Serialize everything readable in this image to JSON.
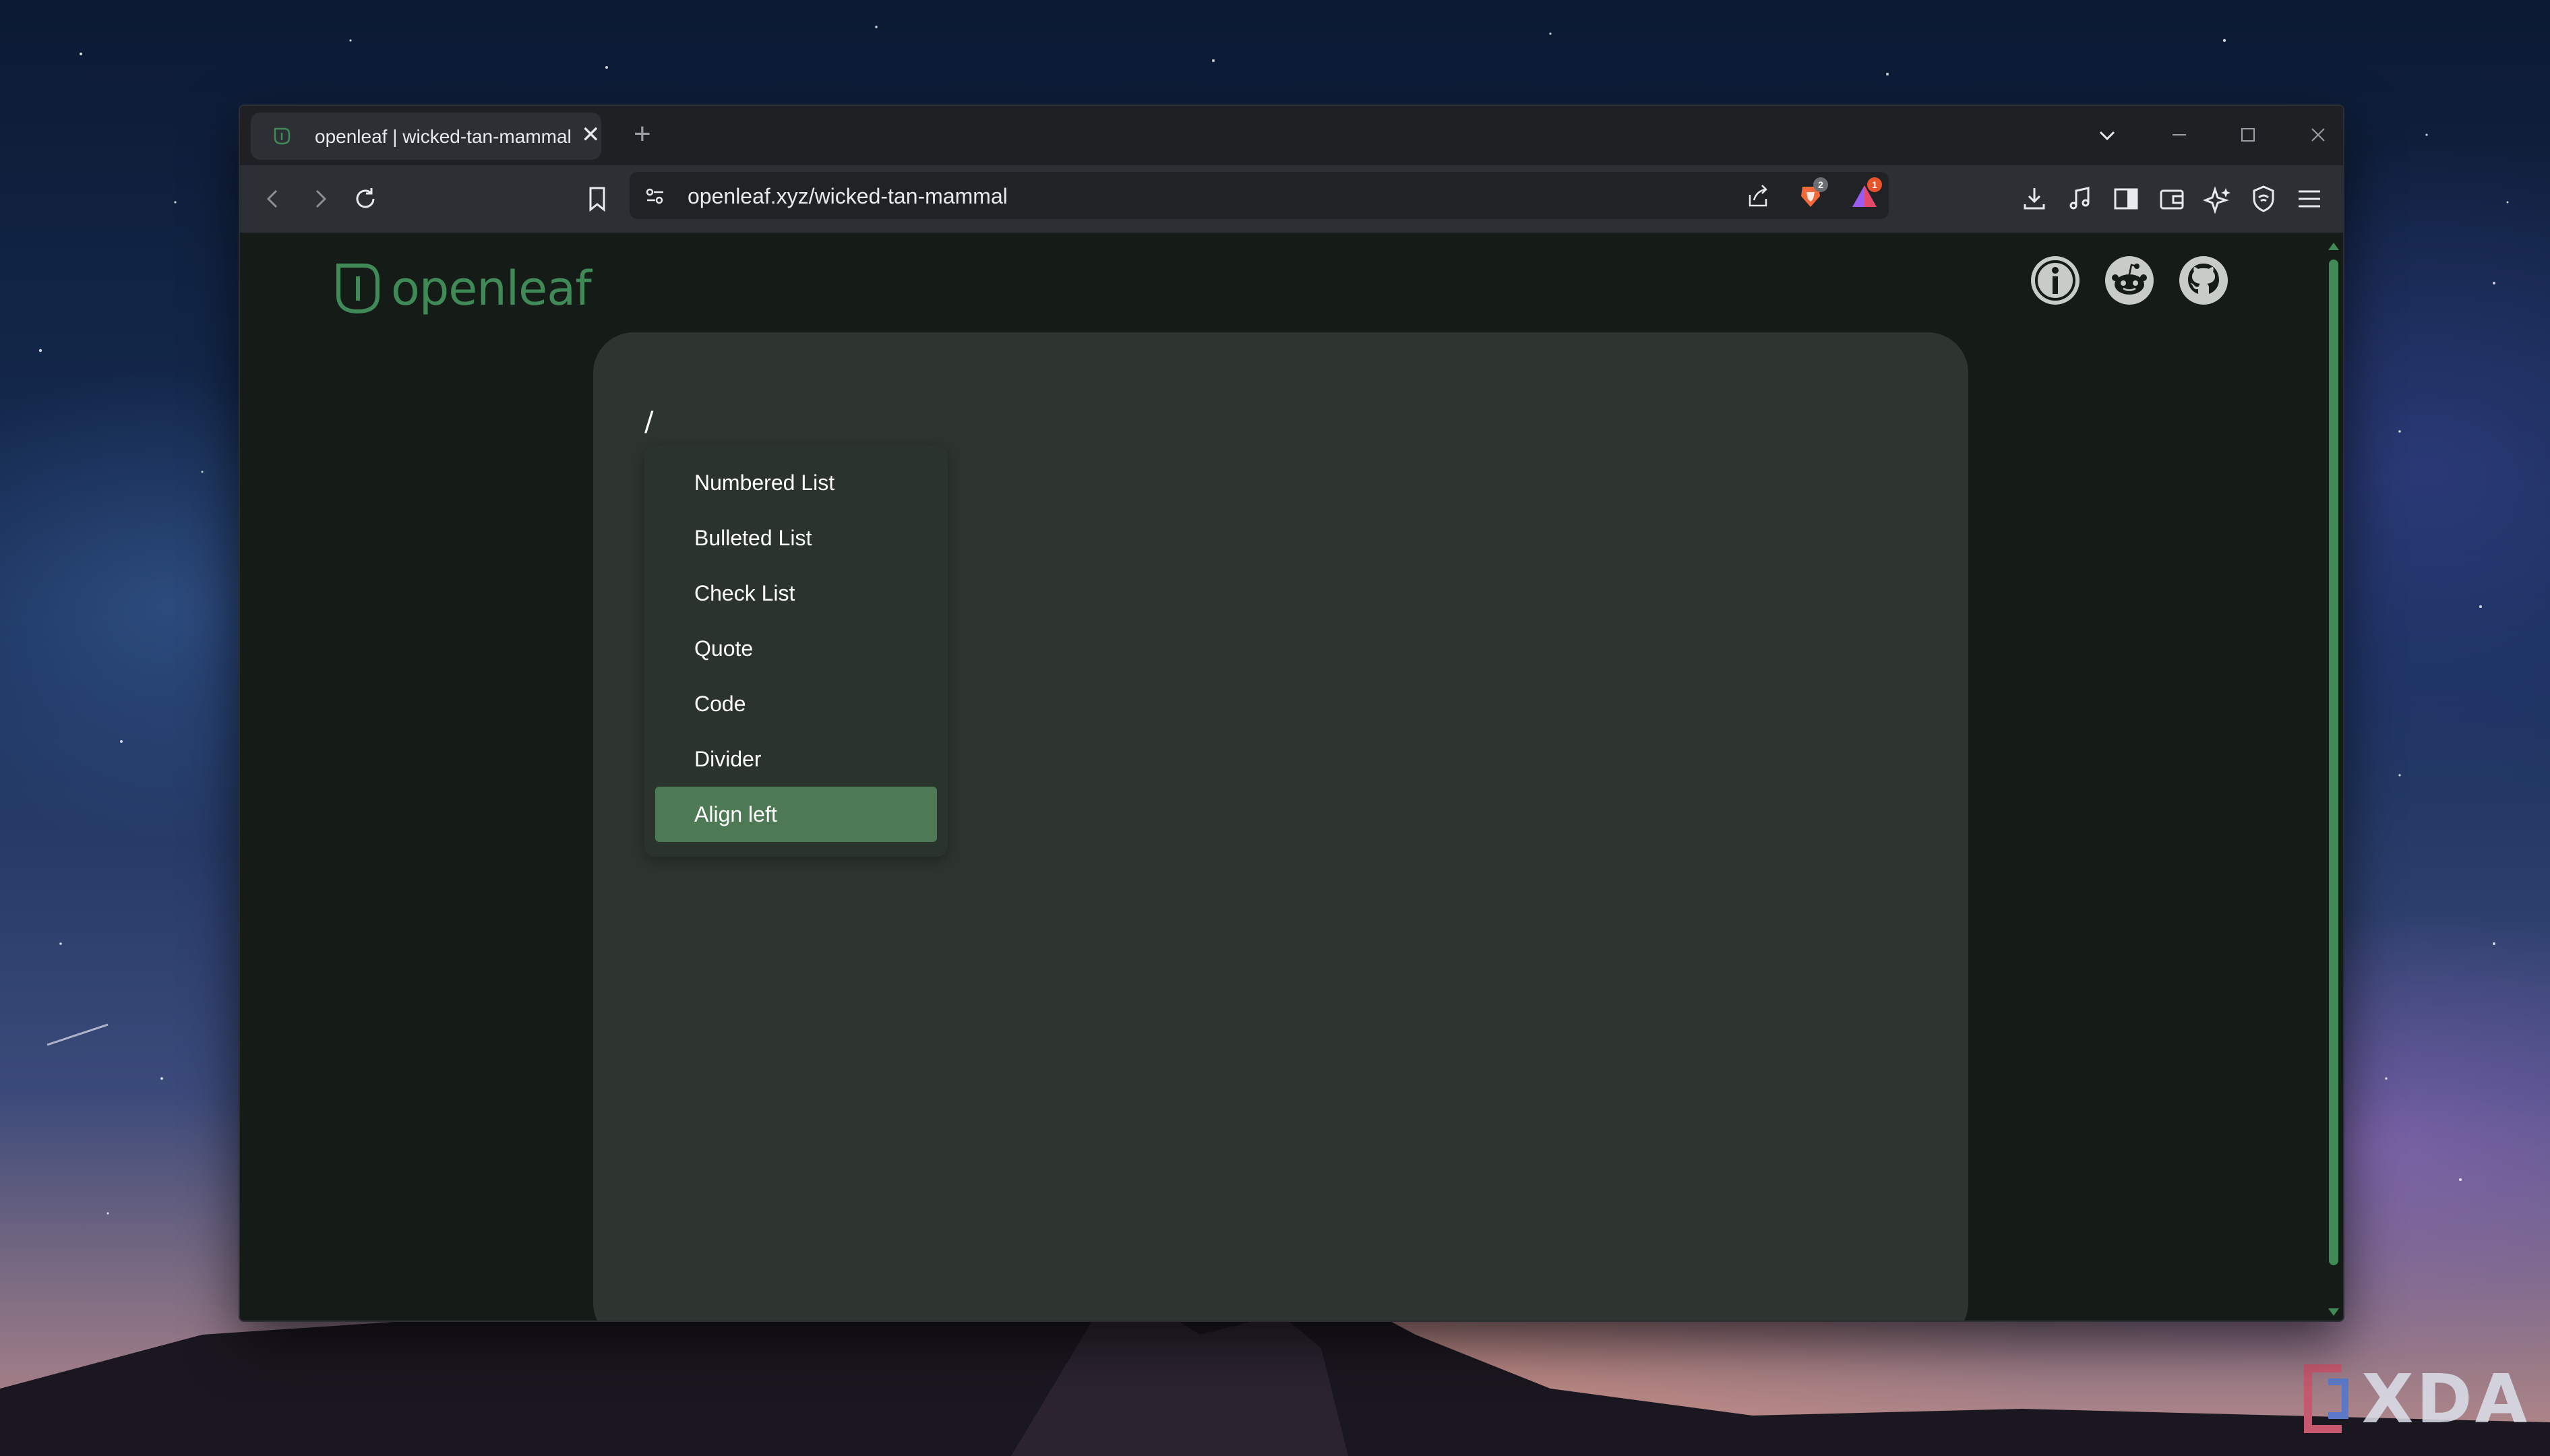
{
  "browser": {
    "tab": {
      "title": "openleaf | wicked-tan-mammal",
      "close_glyph": "✕"
    },
    "new_tab_glyph": "+",
    "url": "openleaf.xyz/wicked-tan-mammal",
    "brave_shield_count": "2",
    "rewards_count": "1"
  },
  "site": {
    "brand_name": "openleaf",
    "accent_color": "#3f8a56",
    "social_icons": [
      "info-icon",
      "reddit-icon",
      "github-icon"
    ]
  },
  "editor": {
    "typed_text": "/",
    "slash_menu": {
      "items": [
        {
          "label": "Numbered List"
        },
        {
          "label": "Bulleted List"
        },
        {
          "label": "Check List"
        },
        {
          "label": "Quote"
        },
        {
          "label": "Code"
        },
        {
          "label": "Divider"
        },
        {
          "label": "Align left"
        }
      ],
      "selected_item": "Align left"
    }
  },
  "watermark": {
    "text": "XDA"
  }
}
